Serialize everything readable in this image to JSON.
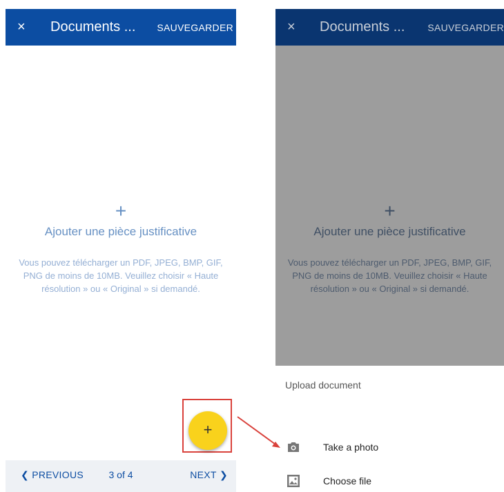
{
  "left_screen": {
    "appbar": {
      "close_icon": "×",
      "title": "Documents ...",
      "save_label": "SAUVEGARDER"
    },
    "upload": {
      "plus": "+",
      "label": "Ajouter une pièce justificative",
      "hint": "Vous pouvez télécharger un PDF, JPEG, BMP, GIF, PNG de moins de 10MB. Veuillez choisir « Haute résolution » ou « Original » si demandé."
    },
    "fab": {
      "label": "+"
    },
    "pagination": {
      "prev": "PREVIOUS",
      "page": "3 of 4",
      "next": "NEXT"
    }
  },
  "right_screen": {
    "appbar": {
      "close_icon": "×",
      "title": "Documents ...",
      "save_label": "SAUVEGARDER"
    },
    "upload": {
      "plus": "+",
      "label": "Ajouter une pièce justificative",
      "hint": "Vous pouvez télécharger un PDF, JPEG, BMP, GIF, PNG de moins de 10MB. Veuillez choisir « Haute résolution » ou « Original » si demandé."
    },
    "sheet": {
      "title": "Upload document",
      "items": [
        {
          "label": "Take a photo",
          "icon": "camera-icon"
        },
        {
          "label": "Choose file",
          "icon": "image-file-icon"
        }
      ]
    }
  },
  "colors": {
    "primary": "#0c4da2",
    "fab": "#f9d21c",
    "annotation": "#d9413b",
    "overlay": "#9d9d9d"
  }
}
